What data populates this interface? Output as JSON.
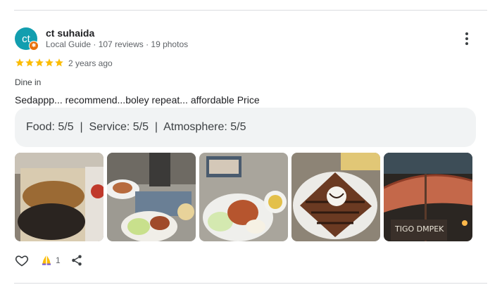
{
  "review": {
    "author": {
      "initials": "ct",
      "name": "ct suhaida",
      "meta": "Local Guide · 107 reviews · 19 photos",
      "avatar_color": "#129eaf",
      "badge_color": "#e8710a"
    },
    "rating": 5,
    "time": "2 years ago",
    "dining_mode": "Dine in",
    "text": "Sedappp... recommend...boley repeat... affordable Price",
    "sub_ratings": "Food: 5/5  |  Service: 5/5  |  Atmosphere: 5/5",
    "photos": [
      {
        "icon": "photo-food-rice"
      },
      {
        "icon": "photo-food-table"
      },
      {
        "icon": "photo-food-plate"
      },
      {
        "icon": "photo-dessert"
      },
      {
        "icon": "photo-night-signboard"
      }
    ],
    "reaction_count": "1",
    "star_color": "#fbbc04"
  }
}
